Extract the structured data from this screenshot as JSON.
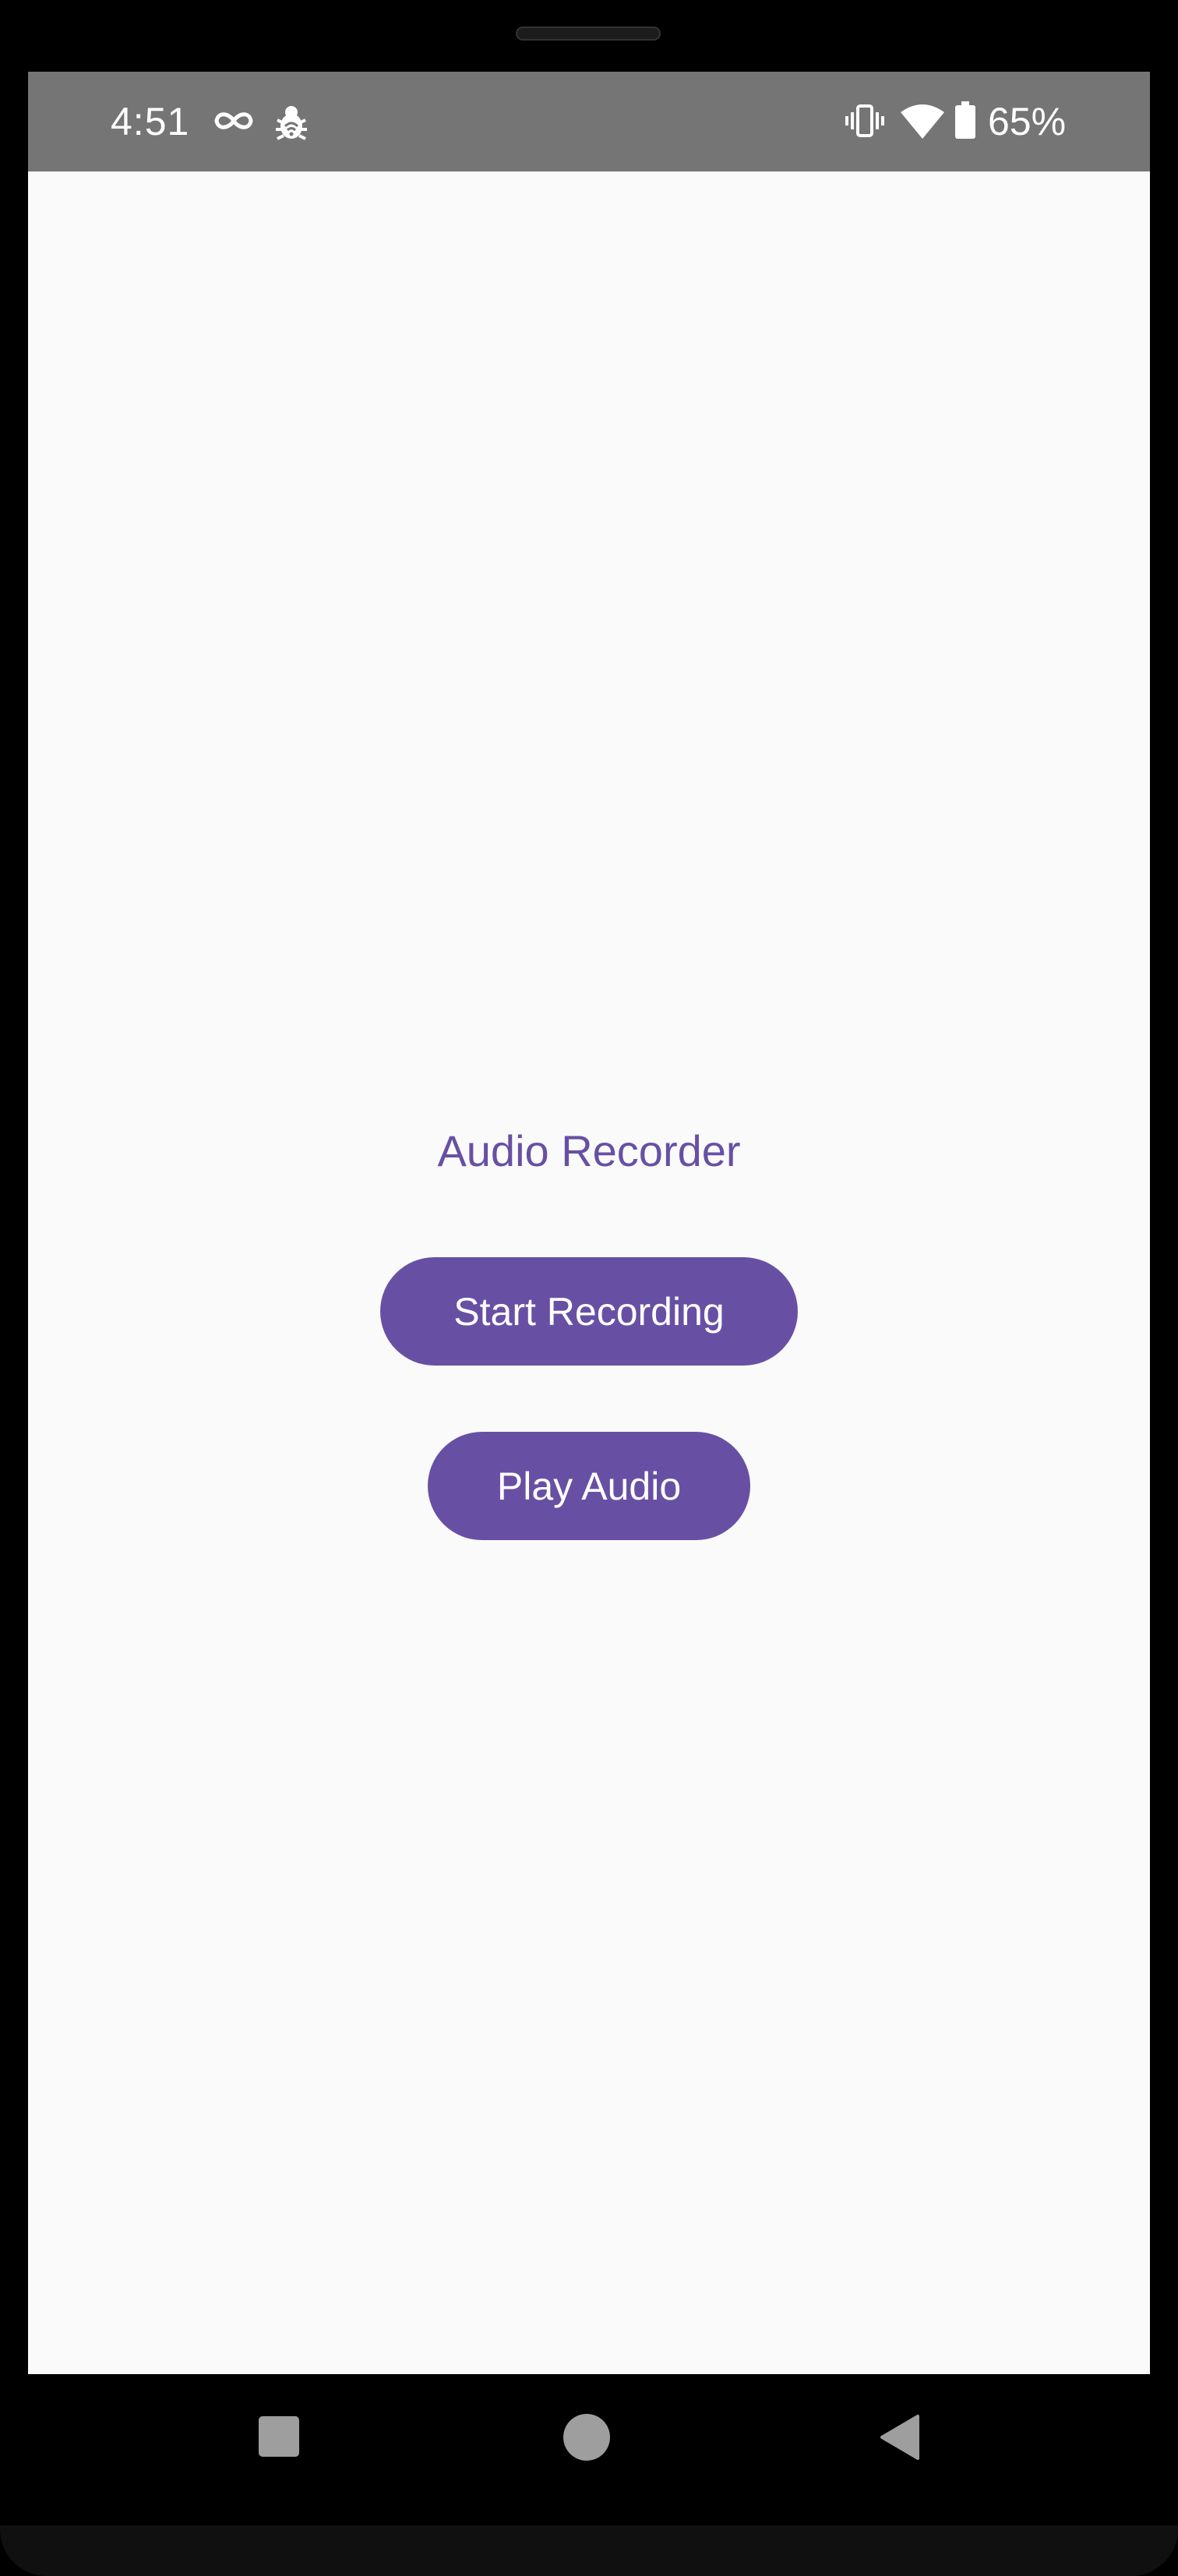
{
  "status_bar": {
    "time": "4:51",
    "battery_percent": "65%",
    "icons": [
      "infinity-icon",
      "bug-icon",
      "vibrate-icon",
      "wifi-icon",
      "battery-icon"
    ]
  },
  "app": {
    "title": "Audio Recorder",
    "start_recording_label": "Start Recording",
    "play_audio_label": "Play Audio"
  },
  "nav_bar": {
    "icons": [
      "recents-icon",
      "home-icon",
      "back-icon"
    ]
  },
  "colors": {
    "accent": "#6750a4",
    "status_bar_bg": "#757575",
    "screen_bg": "#fafafa",
    "nav_icon": "#9e9e9e"
  }
}
